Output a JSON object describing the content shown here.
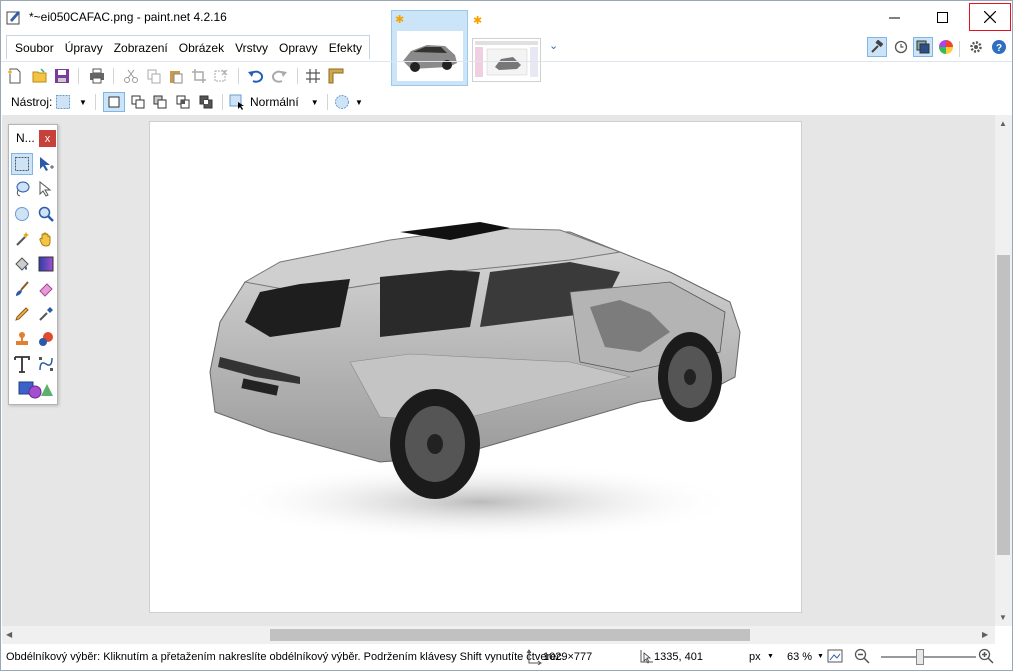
{
  "window": {
    "title": "*~ei050CAFAC.png - paint.net 4.2.16",
    "minimize_glyph": "—",
    "maximize_glyph": "☐",
    "close_glyph": "✕"
  },
  "menu": [
    "Soubor",
    "Úpravy",
    "Zobrazení",
    "Obrázek",
    "Vrstvy",
    "Opravy",
    "Efekty"
  ],
  "images_tabs": {
    "modified_marker": "✱",
    "dropdown_glyph": "⌄"
  },
  "tool_options": {
    "tool_label": "Nástroj:",
    "blend_mode": "Normální"
  },
  "tools_palette": {
    "title": "N...",
    "close_glyph": "x"
  },
  "status": {
    "hint": "Obdélníkový výběr: Kliknutím a přetažením nakreslíte obdélníkový výběr. Podržením klávesy Shift vynutíte čtverec.",
    "image_size": "1029×777",
    "cursor_pos": "1335, 401",
    "unit": "px",
    "zoom": "63 %",
    "zoom_level": 0.63
  },
  "colors": {
    "accent": "#cce4f7",
    "close_border": "#e81123",
    "palette_close": "#c8403a"
  },
  "icons": {
    "toolbar": [
      "new-icon",
      "open-icon",
      "save-icon",
      "print-icon",
      "cut-icon",
      "copy-icon",
      "paste-icon",
      "crop-icon",
      "deselect-icon",
      "undo-icon",
      "redo-icon",
      "grid-icon",
      "ruler-icon"
    ],
    "right": [
      "tools-icon",
      "history-icon",
      "layers-icon",
      "colors-icon",
      "settings-icon",
      "help-icon"
    ]
  }
}
